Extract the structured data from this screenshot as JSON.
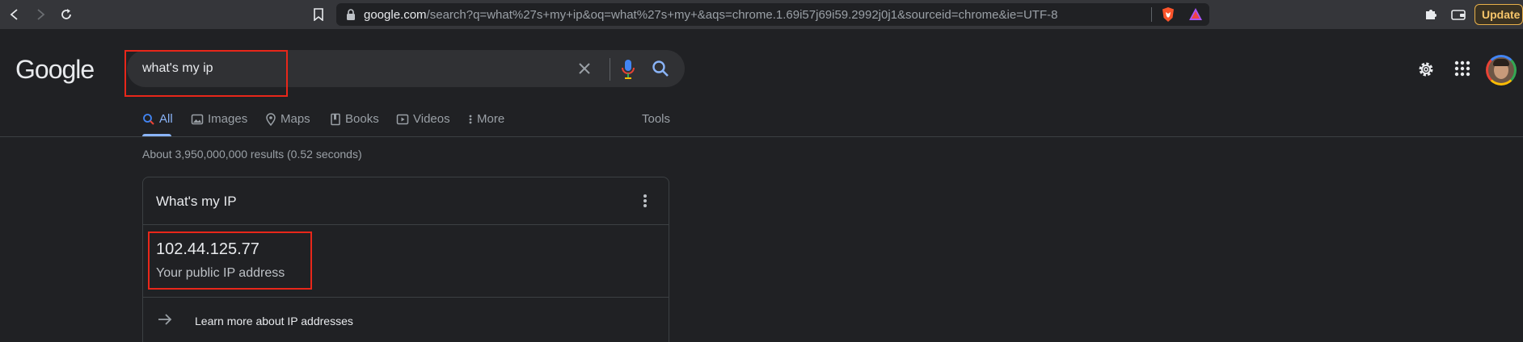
{
  "browser": {
    "url_host": "google.com",
    "url_rest": "/search?q=what%27s+my+ip&oq=what%27s+my+&aqs=chrome.1.69i57j69i59.2992j0j1&sourceid=chrome&ie=UTF-8",
    "update_label": "Update",
    "icons": [
      "back-icon",
      "forward-icon",
      "reload-icon",
      "bookmark-icon",
      "lock-icon",
      "brave-shield-icon",
      "brave-rewards-icon",
      "extensions-icon",
      "wallet-icon"
    ]
  },
  "google": {
    "logo": "Google",
    "search": {
      "query": "what's my ip"
    },
    "tabs": [
      {
        "label": "All",
        "icon": "search-icon",
        "active": true
      },
      {
        "label": "Images",
        "icon": "image-icon"
      },
      {
        "label": "Maps",
        "icon": "map-pin-icon"
      },
      {
        "label": "Books",
        "icon": "book-icon"
      },
      {
        "label": "Videos",
        "icon": "video-icon"
      },
      {
        "label": "More",
        "icon": "more-vert-icon"
      }
    ],
    "tools_label": "Tools",
    "result_stats": "About 3,950,000,000 results (0.52 seconds)",
    "ip_card": {
      "title": "What's my IP",
      "ip": "102.44.125.77",
      "caption": "Your public IP address",
      "link": "Learn more about IP addresses"
    }
  },
  "colors": {
    "background": "#202124",
    "toolbar": "#35363a",
    "accent": "#8ab4f8",
    "highlight": "#e8271a",
    "update": "#f6c56a"
  }
}
